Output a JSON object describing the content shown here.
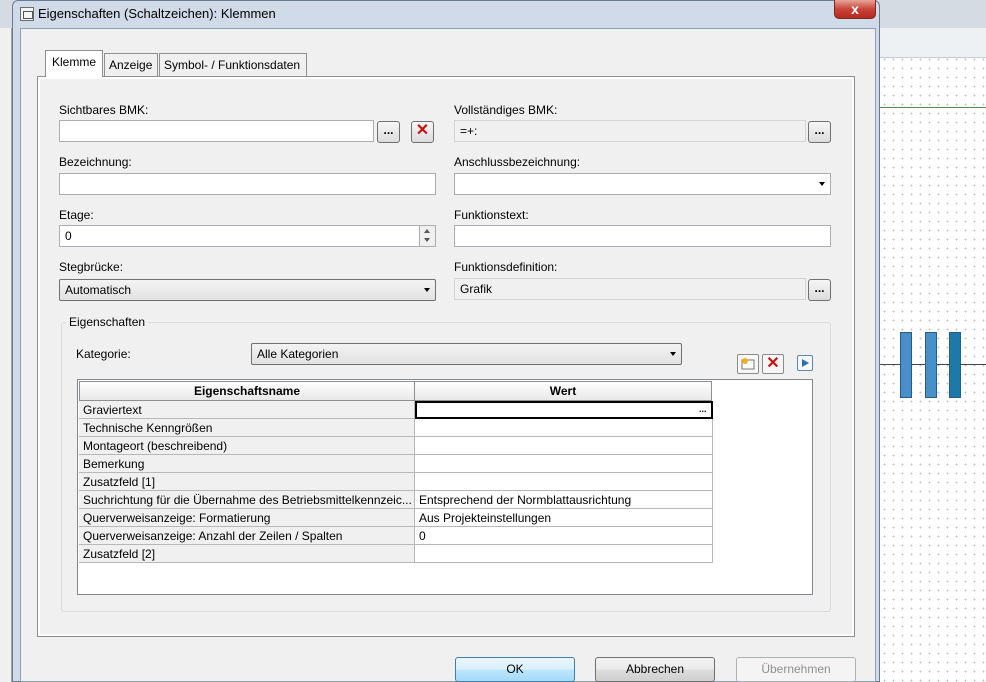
{
  "window": {
    "title": "Eigenschaften (Schaltzeichen): Klemmen",
    "close_label": "x"
  },
  "tabs": [
    {
      "label": "Klemme"
    },
    {
      "label": "Anzeige"
    },
    {
      "label": "Symbol- / Funktionsdaten"
    }
  ],
  "fields": {
    "sichtbares_bmk": {
      "label": "Sichtbares BMK:",
      "value": ""
    },
    "vollstaendiges_bmk": {
      "label": "Vollständiges BMK:",
      "value": "=+:"
    },
    "bezeichnung": {
      "label": "Bezeichnung:",
      "value": ""
    },
    "anschlussbezeichnung": {
      "label": "Anschlussbezeichnung:",
      "value": ""
    },
    "etage": {
      "label": "Etage:",
      "value": "0"
    },
    "funktionstext": {
      "label": "Funktionstext:",
      "value": ""
    },
    "stegbruecke": {
      "label": "Stegbrücke:",
      "value": "Automatisch"
    },
    "funktionsdefinition": {
      "label": "Funktionsdefinition:",
      "value": "Grafik"
    }
  },
  "ellipsis_label": "...",
  "properties": {
    "group_title": "Eigenschaften",
    "kategorie_label": "Kategorie:",
    "kategorie_value": "Alle Kategorien",
    "columns": [
      "Eigenschaftsname",
      "Wert"
    ],
    "rows": [
      {
        "name": "Graviertext",
        "value": ""
      },
      {
        "name": "Technische Kenngrößen",
        "value": ""
      },
      {
        "name": "Montageort (beschreibend)",
        "value": ""
      },
      {
        "name": "Bemerkung",
        "value": ""
      },
      {
        "name": "Zusatzfeld [1]",
        "value": ""
      },
      {
        "name": "Suchrichtung für die Übernahme des Betriebsmittelkennzeic...",
        "value": "Entsprechend der Normblattausrichtung"
      },
      {
        "name": "Querverweisanzeige: Formatierung",
        "value": "Aus Projekteinstellungen"
      },
      {
        "name": "Querverweisanzeige: Anzahl der Zeilen / Spalten",
        "value": "0"
      },
      {
        "name": "Zusatzfeld [2]",
        "value": ""
      }
    ]
  },
  "buttons": {
    "ok": "OK",
    "cancel": "Abbrechen",
    "apply": "Übernehmen"
  },
  "colors": {
    "close": "#c8453a",
    "accent_default": "#3c7fb1",
    "delete_red": "#cc1010",
    "terminal_blue": "#4a90c8"
  }
}
